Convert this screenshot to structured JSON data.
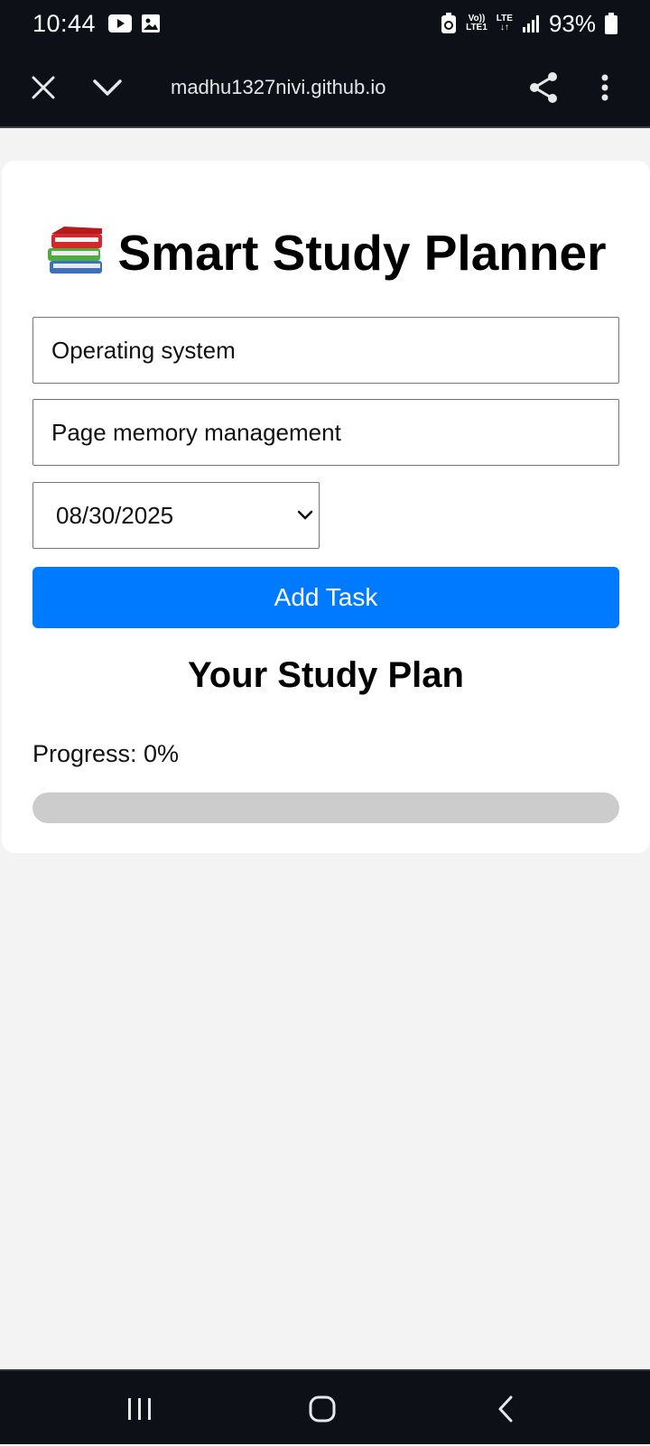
{
  "status_bar": {
    "time": "10:44",
    "left_icons": [
      "youtube-icon",
      "gallery-icon"
    ],
    "network_top": "Vo))",
    "network_bottom": "LTE1",
    "lte": "LTE",
    "battery_percent": "93%"
  },
  "browser": {
    "url": "madhu1327nivi.github.io",
    "icons": [
      "close-icon",
      "chevron-down-icon",
      "share-icon",
      "more-vert-icon"
    ]
  },
  "app": {
    "title": "Smart Study Planner",
    "title_icon": "books-icon",
    "subject_value": "Operating system",
    "topic_value": "Page memory management",
    "date_value": "08/30/2025",
    "add_button_label": "Add Task",
    "plan_heading": "Your Study Plan",
    "progress_text": "Progress: 0%",
    "progress_value": 0
  },
  "colors": {
    "accent": "#007bff",
    "status_bg": "#0d1117",
    "page_bg": "#f3f3f3",
    "progress_track": "#cccccc"
  },
  "nav": {
    "icons": [
      "recent-apps-icon",
      "home-icon",
      "back-icon"
    ]
  }
}
